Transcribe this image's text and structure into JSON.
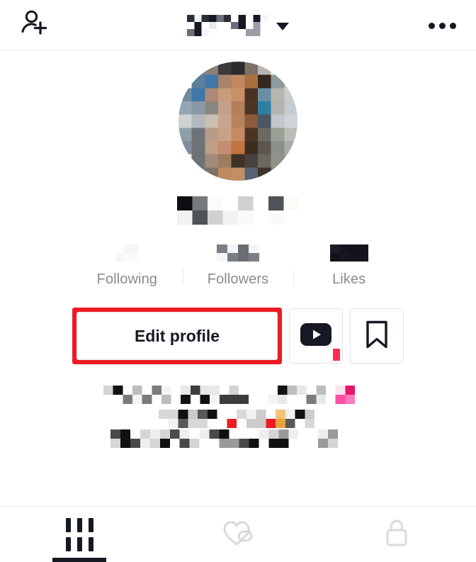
{
  "app": {
    "name": "TikTok Profile",
    "background_color": "#ffffff",
    "accent_color": "#fe2c55",
    "text_color": "#161823",
    "muted_text_color": "#8a8b91",
    "highlight_color": "#ee1b24"
  },
  "header": {
    "add_friend_icon": "add-person-icon",
    "title": "",
    "title_redacted": true,
    "dropdown_icon": "chevron-down-icon",
    "menu_icon": "three-dots-icon"
  },
  "profile": {
    "avatar": {
      "icon": "avatar-image",
      "redacted": true,
      "alt": "profile photo"
    },
    "handle": "",
    "handle_redacted": true,
    "stats": [
      {
        "key": "following",
        "label": "Following",
        "value": "",
        "redacted": true
      },
      {
        "key": "followers",
        "label": "Followers",
        "value": "",
        "redacted": true
      },
      {
        "key": "likes",
        "label": "Likes",
        "value": "",
        "redacted": true
      }
    ],
    "bio": {
      "text": "",
      "redacted": true,
      "lines": 3
    }
  },
  "actions": {
    "edit_profile_label": "Edit profile",
    "edit_profile_highlighted": true,
    "youtube_button": {
      "icon": "youtube-play-icon",
      "badge_visible": true,
      "badge_color": "#fe2c55"
    },
    "bookmark_button": {
      "icon": "bookmark-icon"
    }
  },
  "tabbar": {
    "tabs": [
      {
        "key": "posts",
        "icon": "grid-icon",
        "active": true
      },
      {
        "key": "liked",
        "icon": "heart-hidden-icon",
        "active": false
      },
      {
        "key": "private",
        "icon": "lock-icon",
        "active": false
      }
    ]
  }
}
